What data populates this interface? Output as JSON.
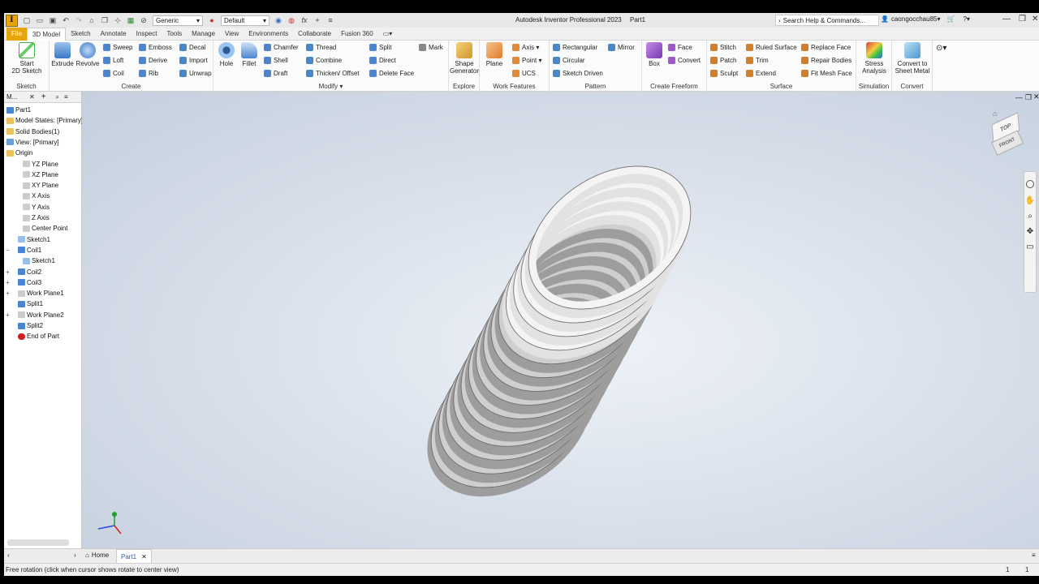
{
  "titlebar": {
    "appearance": "Generic",
    "material": "Default",
    "app_title": "Autodesk Inventor Professional 2023",
    "doc_title": "Part1",
    "search_placeholder": "Search Help & Commands...",
    "user": "caongocchau85"
  },
  "tabs": [
    "File",
    "3D Model",
    "Sketch",
    "Annotate",
    "Inspect",
    "Tools",
    "Manage",
    "View",
    "Environments",
    "Collaborate",
    "Fusion 360"
  ],
  "ribbon": {
    "sketch": {
      "title": "Sketch",
      "start_label": "Start",
      "start_label2": "2D Sketch"
    },
    "create": {
      "title": "Create",
      "extrude": "Extrude",
      "revolve": "Revolve",
      "sweep": "Sweep",
      "loft": "Loft",
      "coil": "Coil",
      "emboss": "Emboss",
      "derive": "Derive",
      "rib": "Rib",
      "decal": "Decal",
      "import": "Import",
      "unwrap": "Unwrap"
    },
    "modify": {
      "title": "Modify",
      "hole": "Hole",
      "fillet": "Fillet",
      "chamfer": "Chamfer",
      "shell": "Shell",
      "draft": "Draft",
      "thread": "Thread",
      "combine": "Combine",
      "thicken": "Thicken/ Offset",
      "split": "Split",
      "direct": "Direct",
      "delete_face": "Delete Face",
      "mark": "Mark"
    },
    "explore": {
      "title": "Explore",
      "shape_gen": "Shape",
      "shape_gen2": "Generator"
    },
    "work_features": {
      "title": "Work Features",
      "plane": "Plane",
      "axis": "Axis",
      "point": "Point",
      "ucs": "UCS"
    },
    "pattern": {
      "title": "Pattern",
      "rectangular": "Rectangular",
      "circular": "Circular",
      "sketch_driven": "Sketch Driven",
      "mirror": "Mirror"
    },
    "freeform": {
      "title": "Create Freeform",
      "box": "Box",
      "face": "Face",
      "convert": "Convert"
    },
    "surface": {
      "title": "Surface",
      "stitch": "Stitch",
      "patch": "Patch",
      "sculpt": "Sculpt",
      "ruled": "Ruled Surface",
      "trim": "Trim",
      "extend": "Extend",
      "replace": "Replace Face",
      "repair": "Repair Bodies",
      "fit_mesh": "Fit Mesh Face"
    },
    "simulation": {
      "title": "Simulation",
      "stress": "Stress",
      "stress2": "Analysis"
    },
    "convert": {
      "title": "Convert",
      "to_sheet": "Convert to",
      "to_sheet2": "Sheet Metal"
    }
  },
  "browser": {
    "header": "M...",
    "items": [
      "Part1",
      "Model States: [Primary]",
      "Solid Bodies(1)",
      "View: [Primary]",
      "Origin",
      "YZ Plane",
      "XZ Plane",
      "XY Plane",
      "X Axis",
      "Y Axis",
      "Z Axis",
      "Center Point",
      "Sketch1",
      "Coil1",
      "Sketch1",
      "Coil2",
      "Coil3",
      "Work Plane1",
      "Split1",
      "Work Plane2",
      "Split2",
      "End of Part"
    ]
  },
  "viewcube": {
    "top": "TOP",
    "front": "FRONT"
  },
  "doctabs": {
    "home": "Home",
    "part": "Part1"
  },
  "status": {
    "text": "Free rotation (click when cursor shows rotate to center view)",
    "count1": "1",
    "count2": "1"
  }
}
